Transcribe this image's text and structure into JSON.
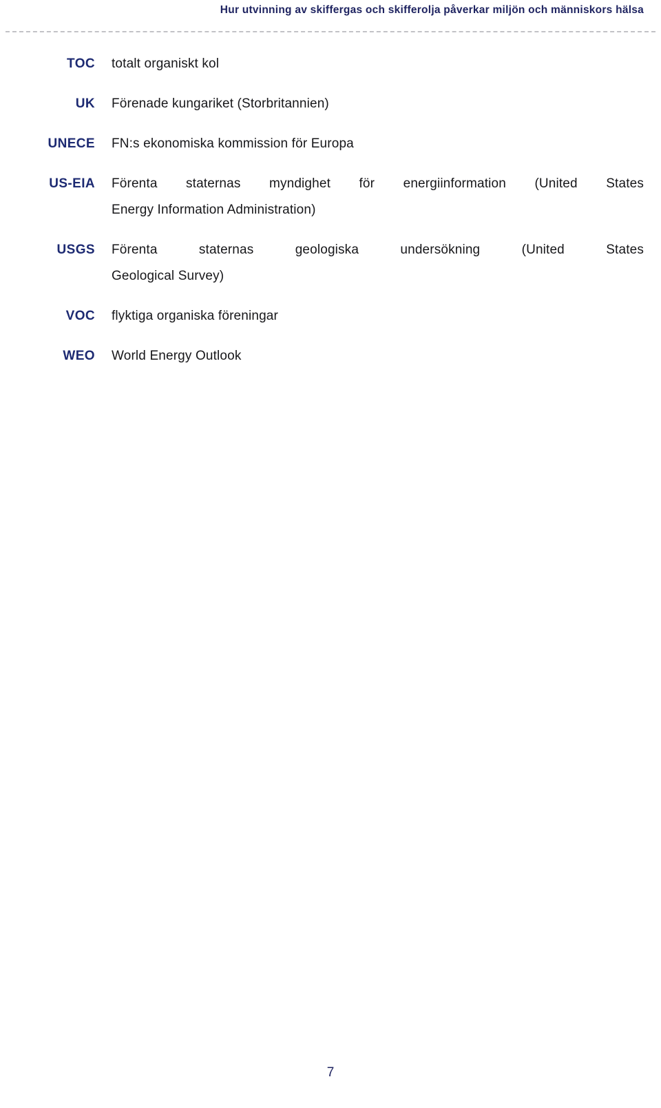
{
  "header": {
    "title": "Hur utvinning av skiffergas och skifferolja påverkar miljön och människors hälsa"
  },
  "colors": {
    "heading_navy": "#1f2461",
    "abbr_navy": "#1d2a72",
    "body_text": "#17171a",
    "rule_gray": "#c2c2c6",
    "page_background": "#ffffff"
  },
  "glossary": {
    "entries": [
      {
        "abbr": "TOC",
        "definition": "totalt organiskt kol",
        "wrapped": false
      },
      {
        "abbr": "UK",
        "definition": "Förenade kungariket (Storbritannien)",
        "wrapped": false
      },
      {
        "abbr": "UNECE",
        "definition": "FN:s ekonomiska kommission för Europa",
        "wrapped": false
      },
      {
        "abbr": "US-EIA",
        "definition": "Förenta staternas myndighet för energiinformation (United States Energy Information Administration)",
        "wrapped": true,
        "line_1": "Förenta staternas myndighet för energiinformation (United States",
        "line_2": "Energy Information Administration)"
      },
      {
        "abbr": "USGS",
        "definition": "Förenta staternas geologiska undersökning (United States Geological Survey)",
        "wrapped": true,
        "line_1": "Förenta staternas geologiska undersökning (United States",
        "line_2": "Geological Survey)"
      },
      {
        "abbr": "VOC",
        "definition": "flyktiga organiska föreningar",
        "wrapped": false
      },
      {
        "abbr": "WEO",
        "definition": "World Energy Outlook",
        "wrapped": false
      }
    ]
  },
  "footer": {
    "page_number": "7"
  }
}
